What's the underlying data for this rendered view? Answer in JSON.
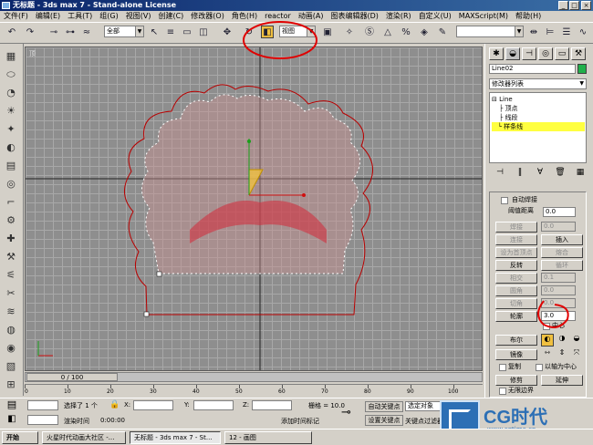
{
  "window": {
    "title": "无标题 - 3ds max 7 - Stand-alone License"
  },
  "menu": [
    "文件(F)",
    "编辑(E)",
    "工具(T)",
    "组(G)",
    "视图(V)",
    "创建(C)",
    "修改器(O)",
    "角色(H)",
    "reactor",
    "动画(A)",
    "图表编辑器(D)",
    "渲染(R)",
    "自定义(U)",
    "MAXScript(M)",
    "帮助(H)"
  ],
  "toolbar": {
    "selection_filter": "全部",
    "coord_system": "视图"
  },
  "viewport": {
    "label": "顶"
  },
  "timeslider": {
    "position": "0 / 100"
  },
  "trackbar": {
    "ticks": [
      "0",
      "10",
      "20",
      "30",
      "40",
      "50",
      "60",
      "70",
      "80",
      "90",
      "100"
    ]
  },
  "status": {
    "selected": "选择了 1 个",
    "x_label": "X:",
    "y_label": "Y:",
    "z_label": "Z:",
    "grid_label": "栅格 = 10.0",
    "render_time_label": "渲染时间",
    "render_time_value": "0:00:00",
    "add_time_tag": "添加时间标记",
    "auto_key": "自动关键点",
    "set_key": "设置关键点",
    "selected_object": "选定对象",
    "key_filters": "关键点过滤器..."
  },
  "taskbar": {
    "start": "开始",
    "tasks": [
      "火星时代动画大社区 -...",
      "无标题 - 3ds max 7 - St...",
      "12 - 画图"
    ]
  },
  "panel": {
    "object_name": "Line02",
    "object_color": "#21b04b",
    "modifier_list": "修改器列表",
    "stack": {
      "root": "Line",
      "vertex": "顶点",
      "segment": "线段",
      "spline": "样条线"
    },
    "auto_weld": "自动焊接",
    "threshold_label": "阈值距离",
    "threshold_value": "0.0",
    "weld": "焊接",
    "weld_value": "0.0",
    "connect": "连接",
    "insert": "插入",
    "make_first": "设为首顶点",
    "fuse": "熔合",
    "reverse": "反转",
    "cycle": "循环",
    "crossinsert": "相交",
    "crossinsert_value": "0.1",
    "fillet": "圆角",
    "fillet_value": "0.0",
    "chamfer": "切角",
    "chamfer_value": "0.0",
    "outline": "轮廓",
    "outline_value": "3.0",
    "center": "中心",
    "boolean": "布尔",
    "mirror": "镜像",
    "copy": "复制",
    "about_pivot": "以轴为中心",
    "trim": "修剪",
    "extend": "延伸",
    "infinite_bounds": "无限边界"
  },
  "watermark": {
    "brand": "CG时代",
    "url": "www.cgtime.cn"
  }
}
